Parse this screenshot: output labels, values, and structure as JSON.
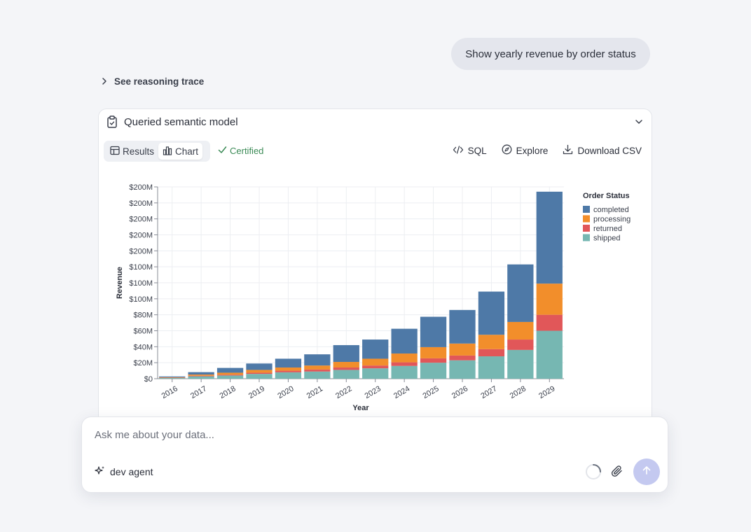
{
  "user_message": "Show yearly revenue by order status",
  "reasoning_toggle": "See reasoning trace",
  "card": {
    "title": "Queried semantic model",
    "tabs": [
      {
        "label": "Results",
        "icon": "table-icon",
        "active": false
      },
      {
        "label": "Chart",
        "icon": "bar-chart-icon",
        "active": true
      }
    ],
    "certified": "Certified",
    "actions": [
      {
        "label": "SQL",
        "icon": "code-icon"
      },
      {
        "label": "Explore",
        "icon": "compass-icon"
      },
      {
        "label": "Download CSV",
        "icon": "download-icon"
      }
    ]
  },
  "chart_data": {
    "type": "bar",
    "stacked": true,
    "xlabel": "Year",
    "ylabel": "Revenue",
    "legend_title": "Order Status",
    "legend_position": "top-right",
    "grid": true,
    "ylim": [
      0,
      240000000
    ],
    "y_ticks": [
      {
        "value": 0,
        "label": "$0"
      },
      {
        "value": 20000000,
        "label": "$20M"
      },
      {
        "value": 40000000,
        "label": "$40M"
      },
      {
        "value": 60000000,
        "label": "$60M"
      },
      {
        "value": 80000000,
        "label": "$80M"
      },
      {
        "value": 100000000,
        "label": "$100M"
      },
      {
        "value": 120000000,
        "label": "$100M"
      },
      {
        "value": 140000000,
        "label": "$100M"
      },
      {
        "value": 160000000,
        "label": "$200M"
      },
      {
        "value": 180000000,
        "label": "$200M"
      },
      {
        "value": 200000000,
        "label": "$200M"
      },
      {
        "value": 220000000,
        "label": "$200M"
      },
      {
        "value": 240000000,
        "label": "$200M"
      }
    ],
    "categories": [
      "2016",
      "2017",
      "2018",
      "2019",
      "2020",
      "2021",
      "2022",
      "2023",
      "2024",
      "2025",
      "2026",
      "2027",
      "2028",
      "2029"
    ],
    "series": [
      {
        "name": "shipped",
        "color": "#76b7b2",
        "values": [
          1000000,
          3000000,
          4000000,
          6000000,
          8000000,
          9000000,
          11000000,
          13000000,
          16000000,
          20000000,
          23000000,
          28000000,
          36000000,
          60000000
        ]
      },
      {
        "name": "returned",
        "color": "#e15759",
        "values": [
          300000,
          700000,
          1000000,
          1500000,
          2000000,
          2500000,
          3000000,
          3500000,
          4500000,
          5500000,
          6000000,
          9000000,
          13000000,
          20000000
        ]
      },
      {
        "name": "processing",
        "color": "#f28e2b",
        "values": [
          500000,
          1500000,
          2500000,
          3500000,
          4000000,
          5000000,
          7000000,
          8500000,
          11000000,
          14000000,
          15000000,
          18000000,
          22000000,
          39000000
        ]
      },
      {
        "name": "completed",
        "color": "#4e79a7",
        "values": [
          1000000,
          3000000,
          6000000,
          8000000,
          11000000,
          14000000,
          21000000,
          24000000,
          31000000,
          38000000,
          42000000,
          54000000,
          72000000,
          115000000
        ]
      }
    ],
    "legend_order": [
      "completed",
      "processing",
      "returned",
      "shipped"
    ]
  },
  "composer": {
    "placeholder": "Ask me about your data...",
    "agent_label": "dev agent"
  }
}
